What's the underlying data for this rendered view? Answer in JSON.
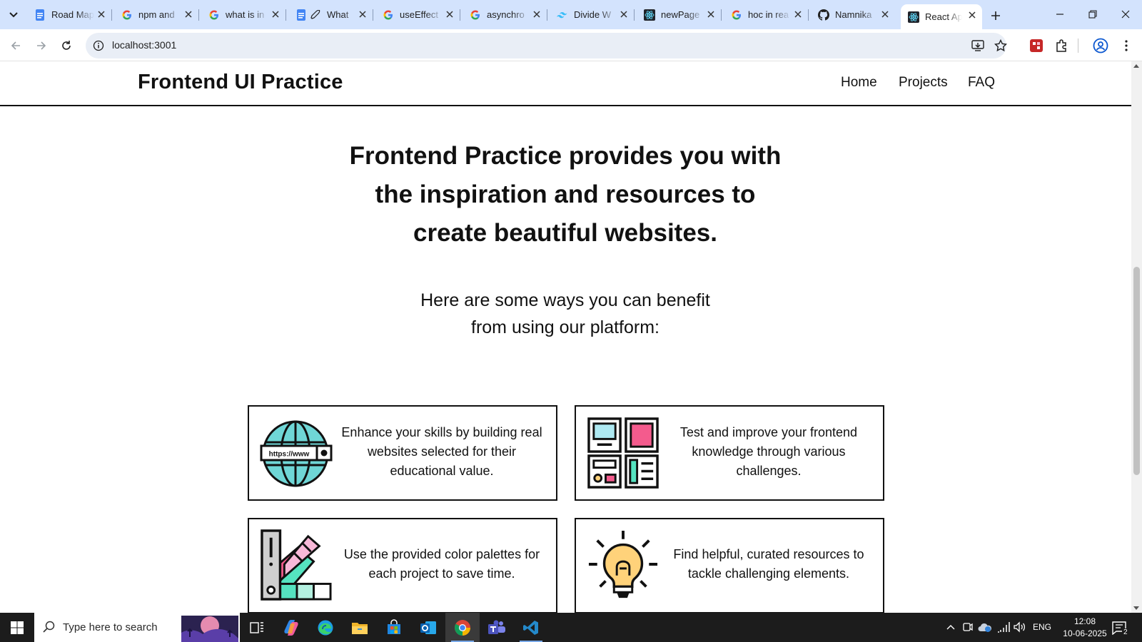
{
  "browser": {
    "tabs": [
      {
        "title": "Road Map",
        "favicon": "google-docs-icon"
      },
      {
        "title": "npm and",
        "favicon": "google-icon"
      },
      {
        "title": "what is in",
        "favicon": "google-icon"
      },
      {
        "title": "What",
        "favicon": "google-docs-icon"
      },
      {
        "title": "useEffect",
        "favicon": "google-icon"
      },
      {
        "title": "asynchro",
        "favicon": "google-icon"
      },
      {
        "title": "Divide W",
        "favicon": "tailwind-icon"
      },
      {
        "title": "newPage",
        "favicon": "react-icon"
      },
      {
        "title": "hoc in rea",
        "favicon": "google-icon"
      },
      {
        "title": "Namnika",
        "favicon": "github-icon"
      },
      {
        "title": "React Ap",
        "favicon": "react-icon",
        "active": true
      }
    ],
    "url": "localhost:3001"
  },
  "site": {
    "brand": "Frontend UI Practice",
    "nav": [
      "Home",
      "Projects",
      "FAQ"
    ],
    "hero": [
      "Frontend Practice provides you with",
      "the inspiration and resources to",
      "create beautiful websites."
    ],
    "subtitle": [
      "Here are some ways you can benefit",
      "from using our platform:"
    ],
    "cards": [
      {
        "icon": "globe-www-icon",
        "lines": [
          "Enhance your skills by building real",
          "websites selected for their",
          "educational value."
        ]
      },
      {
        "icon": "layout-blocks-icon",
        "lines": [
          "Test and improve your frontend",
          "knowledge through various",
          "challenges."
        ]
      },
      {
        "icon": "color-palette-icon",
        "lines": [
          "Use the provided color palettes for",
          "each project to save time."
        ]
      },
      {
        "icon": "lightbulb-icon",
        "lines": [
          "Find helpful, curated resources to",
          "tackle challenging elements."
        ]
      }
    ]
  },
  "taskbar": {
    "search_placeholder": "Type here to search",
    "language": "ENG",
    "time": "12:08",
    "date": "10-06-2025",
    "notification_count": "2"
  },
  "colors": {
    "tabstrip": "#d3e3fd",
    "teal": "#6fd6d6",
    "pink": "#f45b8d",
    "mint": "#55e3c0",
    "bulb": "#ffd27a"
  }
}
